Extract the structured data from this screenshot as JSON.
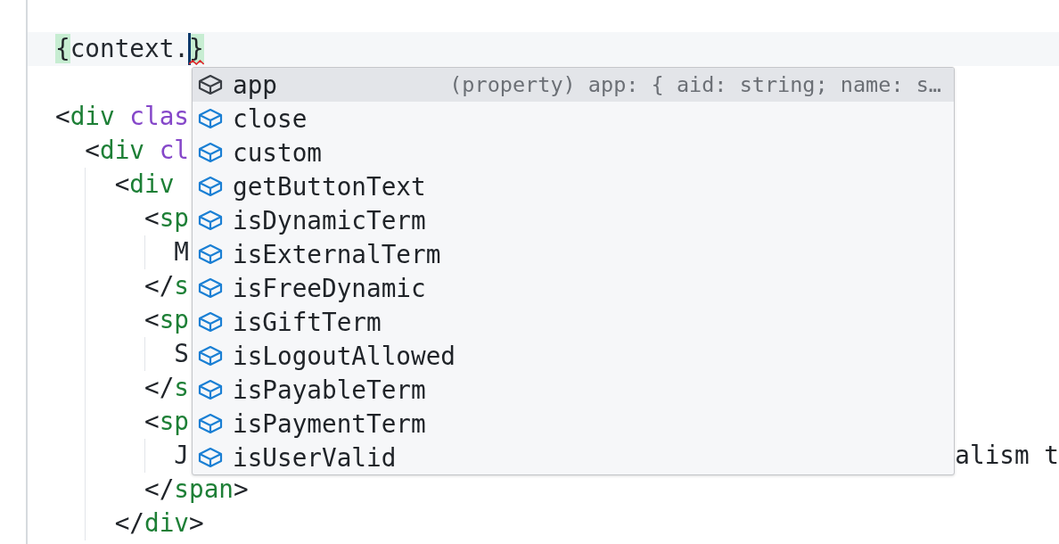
{
  "editor": {
    "lines": [
      {
        "kind": "code",
        "current": true,
        "tokens": [
          {
            "text": "{",
            "kind": "brace",
            "matched": true,
            "caret_before": false,
            "error": false
          },
          {
            "text": "context.",
            "kind": "text",
            "caret_before": false,
            "error": false
          },
          {
            "text": "}",
            "kind": "brace",
            "matched": true,
            "caret_before": true,
            "error": true
          }
        ]
      },
      {
        "kind": "blank"
      },
      {
        "kind": "code",
        "current": false,
        "tokens": [
          {
            "text": "<",
            "kind": "punct"
          },
          {
            "text": "div",
            "kind": "tag"
          },
          {
            "text": "clas",
            "kind": "attr"
          }
        ],
        "children": [
          {
            "kind": "code",
            "current": false,
            "tokens": [
              {
                "text": "<",
                "kind": "punct"
              },
              {
                "text": "div",
                "kind": "tag"
              },
              {
                "text": "cl",
                "kind": "attr"
              }
            ],
            "children": [
              {
                "kind": "code",
                "current": false,
                "tokens": [
                  {
                    "text": "<",
                    "kind": "punct"
                  },
                  {
                    "text": "div",
                    "kind": "tag"
                  }
                ],
                "children": [
                  {
                    "kind": "code",
                    "current": false,
                    "tokens": [
                      {
                        "text": "<",
                        "kind": "punct"
                      },
                      {
                        "text": "sp",
                        "kind": "tag"
                      }
                    ],
                    "children": [
                      {
                        "kind": "code",
                        "current": false,
                        "tokens": [
                          {
                            "text": "M",
                            "kind": "text"
                          }
                        ]
                      }
                    ]
                  },
                  {
                    "kind": "code",
                    "current": false,
                    "tokens": [
                      {
                        "text": "</",
                        "kind": "punct"
                      },
                      {
                        "text": "s",
                        "kind": "tag"
                      }
                    ]
                  },
                  {
                    "kind": "code",
                    "current": false,
                    "tokens": [
                      {
                        "text": "<",
                        "kind": "punct"
                      },
                      {
                        "text": "sp",
                        "kind": "tag"
                      }
                    ],
                    "children": [
                      {
                        "kind": "code",
                        "current": false,
                        "tokens": [
                          {
                            "text": "S",
                            "kind": "text"
                          }
                        ]
                      }
                    ]
                  },
                  {
                    "kind": "code",
                    "current": false,
                    "tokens": [
                      {
                        "text": "</",
                        "kind": "punct"
                      },
                      {
                        "text": "s",
                        "kind": "tag"
                      }
                    ]
                  },
                  {
                    "kind": "code",
                    "current": false,
                    "tokens": [
                      {
                        "text": "<",
                        "kind": "punct"
                      },
                      {
                        "text": "sp",
                        "kind": "tag"
                      }
                    ],
                    "children": [
                      {
                        "kind": "code",
                        "current": false,
                        "tokens": [
                          {
                            "text": "J",
                            "kind": "text"
                          }
                        ],
                        "tail": "alism t"
                      }
                    ]
                  },
                  {
                    "kind": "code",
                    "current": false,
                    "tokens": [
                      {
                        "text": "</",
                        "kind": "punct"
                      },
                      {
                        "text": "span",
                        "kind": "tag"
                      },
                      {
                        "text": ">",
                        "kind": "punct"
                      }
                    ]
                  }
                ]
              },
              {
                "kind": "code",
                "current": false,
                "tokens": [
                  {
                    "text": "</",
                    "kind": "punct"
                  },
                  {
                    "text": "div",
                    "kind": "tag"
                  },
                  {
                    "text": ">",
                    "kind": "punct"
                  }
                ]
              }
            ]
          }
        ]
      }
    ]
  },
  "suggestions": {
    "items": [
      {
        "label": "app",
        "selected": true,
        "detail": "(property) app: { aid: string; name: s…"
      },
      {
        "label": "close",
        "selected": false
      },
      {
        "label": "custom",
        "selected": false
      },
      {
        "label": "getButtonText",
        "selected": false
      },
      {
        "label": "isDynamicTerm",
        "selected": false
      },
      {
        "label": "isExternalTerm",
        "selected": false
      },
      {
        "label": "isFreeDynamic",
        "selected": false
      },
      {
        "label": "isGiftTerm",
        "selected": false
      },
      {
        "label": "isLogoutAllowed",
        "selected": false
      },
      {
        "label": "isPayableTerm",
        "selected": false
      },
      {
        "label": "isPaymentTerm",
        "selected": false
      },
      {
        "label": "isUserValid",
        "selected": false
      }
    ]
  }
}
